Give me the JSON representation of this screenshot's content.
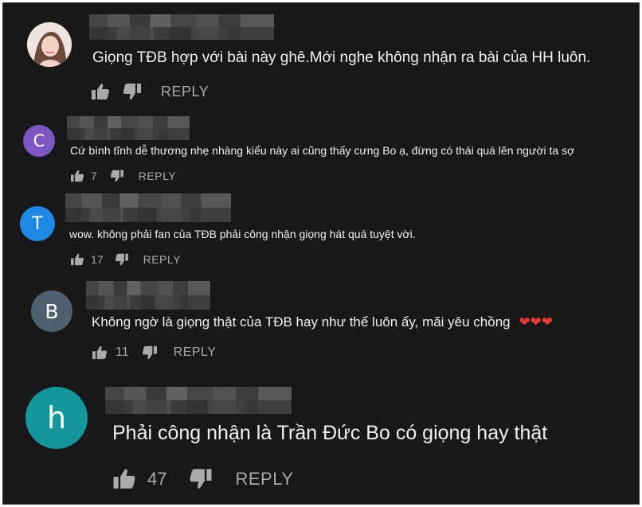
{
  "comments": [
    {
      "avatar_letter": "",
      "avatar_color": "#e9d6d3",
      "text": "Giọng TĐB hợp với bài này ghê.Mới nghe không nhận ra bài của HH luôn.",
      "likes": "",
      "reply_label": "REPLY"
    },
    {
      "avatar_letter": "C",
      "avatar_color": "#7e57c2",
      "text": "Cứ bình tĩnh dễ thương nhẹ nhàng kiểu này ai cũng thấy cưng Bo ạ, đừng có thái quá lên người ta sợ",
      "likes": "7",
      "reply_label": "REPLY"
    },
    {
      "avatar_letter": "T",
      "avatar_color": "#1e88e5",
      "text": "wow. không phải  fan của TĐB phải  công nhận giọng hát quá tuyệt vời.",
      "likes": "17",
      "reply_label": "REPLY"
    },
    {
      "avatar_letter": "B",
      "avatar_color": "#4e6070",
      "text": "Không ngờ là giọng thật của TĐB hay như thế luôn ấy, mãi yêu chồng",
      "emoji": "❤❤❤",
      "likes": "11",
      "reply_label": "REPLY"
    },
    {
      "avatar_letter": "h",
      "avatar_color": "#13979a",
      "text": "Phải công nhận là Trần Đức Bo có giọng hay thật",
      "likes": "47",
      "reply_label": "REPLY"
    }
  ]
}
